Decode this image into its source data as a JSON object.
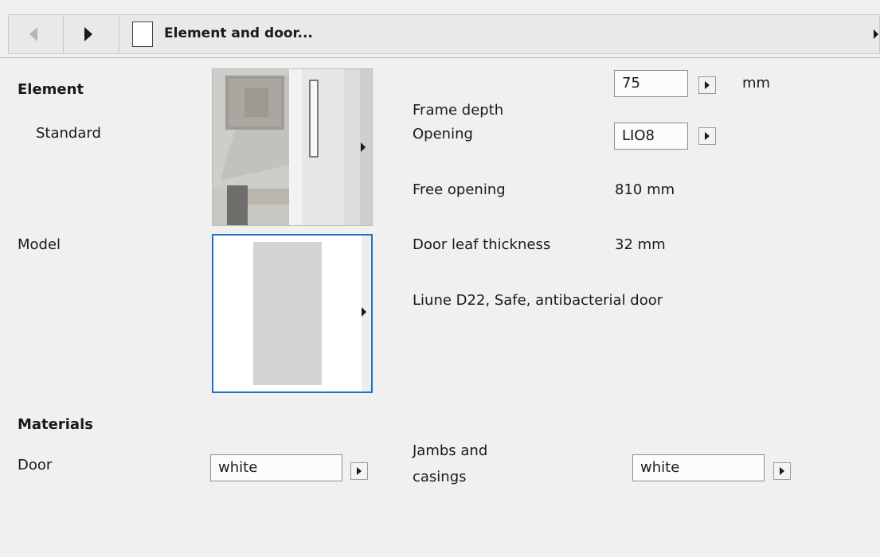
{
  "toolbar": {
    "title": "Element and door..."
  },
  "element": {
    "heading": "Element",
    "type": "Standard"
  },
  "model": {
    "label": "Model"
  },
  "properties": {
    "frame_depth_label": "Frame depth",
    "frame_depth_value": "75",
    "frame_depth_unit": "mm",
    "opening_label": "Opening",
    "opening_value": "LIO8",
    "free_opening_label": "Free opening",
    "free_opening_value": "810 mm",
    "door_leaf_label": "Door leaf thickness",
    "door_leaf_value": "32 mm",
    "description": "Liune D22, Safe, antibacterial door"
  },
  "materials": {
    "heading": "Materials",
    "door_label": "Door",
    "door_value": "white",
    "jambs_label_line1": "Jambs and",
    "jambs_label_line2": "casings",
    "jambs_value": "white"
  },
  "icons": {
    "back": "triangle-left-icon",
    "forward": "triangle-right-icon",
    "document": "document-icon",
    "expand": "triangle-right-icon"
  }
}
